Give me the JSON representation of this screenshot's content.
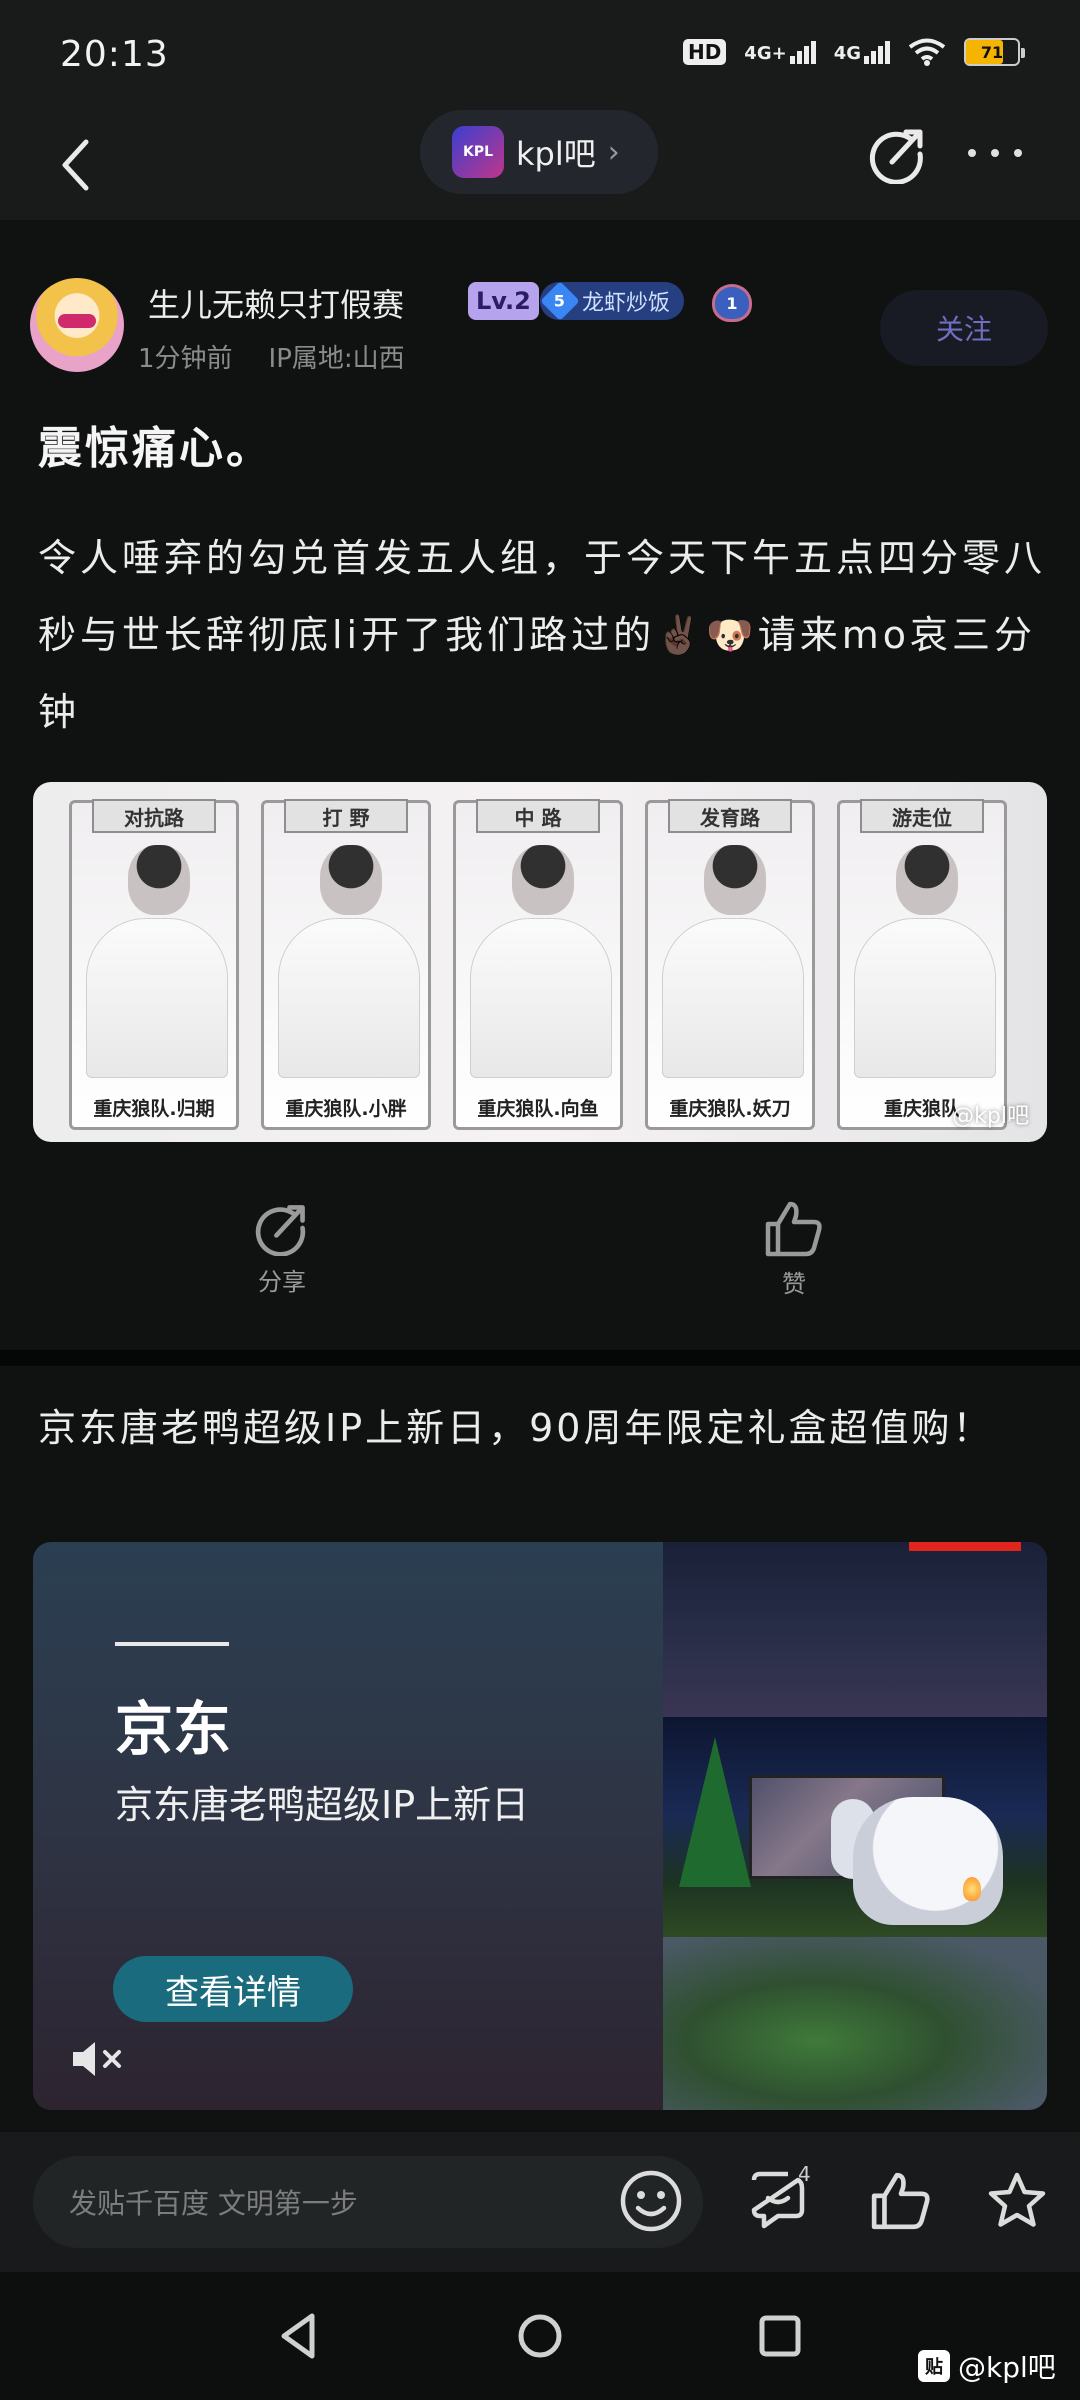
{
  "status_bar": {
    "time": "20:13",
    "hd": "HD",
    "net1": "4G+",
    "net2": "4G",
    "battery": "71",
    "battery_level": 0.71
  },
  "header": {
    "forum_logo_text": "KPL",
    "forum_name": "kpl吧",
    "chevron": "›"
  },
  "post": {
    "author": {
      "username": "生儿无赖只打假赛",
      "level": "Lv.2",
      "title_rank": "5",
      "title": "龙虾炒饭",
      "medal": "1",
      "time": "1分钟前",
      "ip": "IP属地:山西"
    },
    "follow_label": "关注",
    "title": "震惊痛心。",
    "body": "令人唾弃的勾兑首发五人组，于今天下午五点四分零八秒与世长辞彻底li开了我们路过的✌🏿🐶请来mo哀三分钟",
    "image": {
      "players": [
        {
          "role": "对抗路",
          "name": "重庆狼队.归期"
        },
        {
          "role": "打 野",
          "name": "重庆狼队.小胖"
        },
        {
          "role": "中 路",
          "name": "重庆狼队.向鱼"
        },
        {
          "role": "发育路",
          "name": "重庆狼队.妖刀"
        },
        {
          "role": "游走位",
          "name": "重庆狼队"
        }
      ],
      "watermark": "@kpl吧"
    },
    "actions": {
      "share_label": "分享",
      "like_label": "赞"
    }
  },
  "ad": {
    "text": "京东唐老鸭超级IP上新日，90周年限定礼盒超值购！",
    "brand": "京东",
    "subtitle": "京东唐老鸭超级IP上新日",
    "cta": "查看详情"
  },
  "bottom_bar": {
    "reply_placeholder": "发贴千百度 文明第一步",
    "comment_count": "4"
  },
  "watermark": {
    "logo": "贴",
    "text": "@kpl吧"
  },
  "colors": {
    "background": "#101212",
    "bar": "#191b1b",
    "level_badge": "#b6a3ee",
    "cta": "#1a6b7d",
    "battery": "#f5b400"
  }
}
